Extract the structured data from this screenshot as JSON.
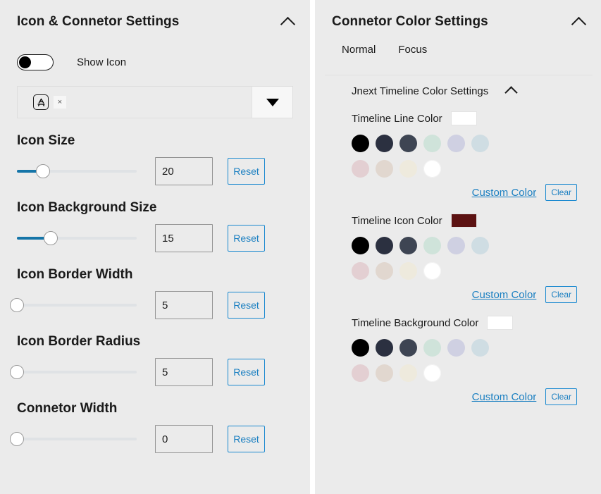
{
  "left_panel": {
    "title": "Icon & Connetor Settings",
    "collapse_icon": "chevron-up-icon",
    "toggle": {
      "label": "Show Icon",
      "state": "off"
    },
    "icon_select": {
      "selected_icon": "app-store-icon",
      "remove_label": "×",
      "dropdown_icon": "caret-down-icon"
    },
    "sliders": [
      {
        "label": "Icon Size",
        "value": "20",
        "fill_percent": 22,
        "reset_label": "Reset"
      },
      {
        "label": "Icon Background Size",
        "value": "15",
        "fill_percent": 28,
        "reset_label": "Reset"
      },
      {
        "label": "Icon Border Width",
        "value": "5",
        "fill_percent": 0,
        "reset_label": "Reset"
      },
      {
        "label": "Icon Border Radius",
        "value": "5",
        "fill_percent": 0,
        "reset_label": "Reset"
      },
      {
        "label": "Connetor Width",
        "value": "0",
        "fill_percent": 0,
        "reset_label": "Reset"
      }
    ]
  },
  "right_panel": {
    "title": "Connetor Color Settings",
    "collapse_icon": "chevron-up-icon",
    "tabs": [
      {
        "label": "Normal",
        "active": true
      },
      {
        "label": "Focus",
        "active": false
      }
    ],
    "subsection": {
      "title": "Jnext Timeline Color Settings",
      "collapse_icon": "chevron-up-icon"
    },
    "palette": [
      "#000000",
      "#2b3040",
      "#3e4553",
      "#cfe3da",
      "#cfd0e2",
      "#cfdde3",
      "#e3cfd2",
      "#e1d7cf",
      "#eeeadd",
      "#ffffff"
    ],
    "color_groups": [
      {
        "label": "Timeline Line Color",
        "preview_color": "#ffffff",
        "custom_color_label": "Custom Color",
        "clear_label": "Clear"
      },
      {
        "label": "Timeline Icon Color",
        "preview_color": "#5c1212",
        "custom_color_label": "Custom Color",
        "clear_label": "Clear"
      },
      {
        "label": "Timeline Background Color",
        "preview_color": "#ffffff",
        "custom_color_label": "Custom Color",
        "clear_label": "Clear"
      }
    ]
  },
  "theme": {
    "panel_bg": "#ebebeb",
    "accent_blue": "#1a7fc1",
    "slider_fill": "#1575a8",
    "text": "#1a1a1a"
  }
}
